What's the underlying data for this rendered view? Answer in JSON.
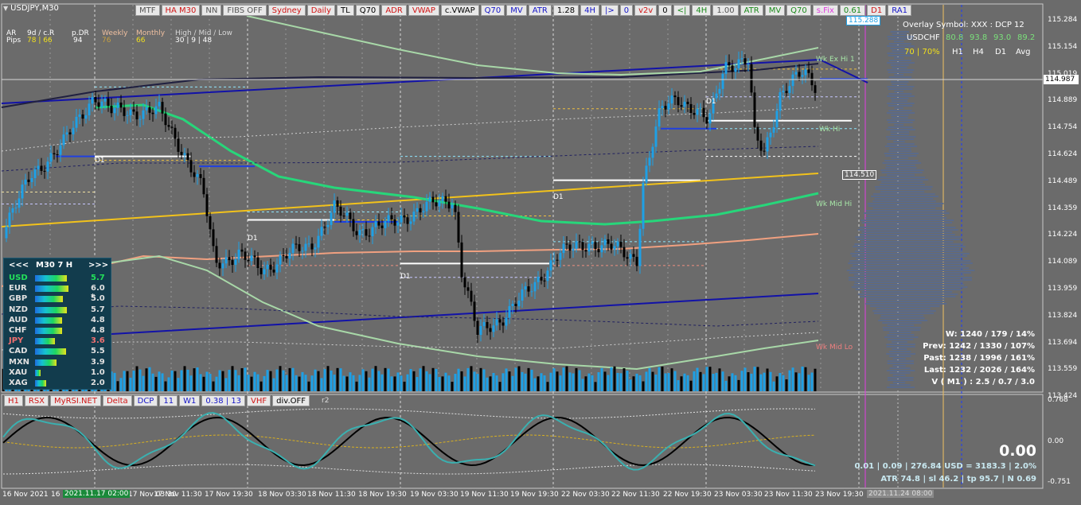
{
  "window": {
    "symbol_title": "USDJPY,M30"
  },
  "toolbar": [
    {
      "label": "MTF",
      "color": "#555555"
    },
    {
      "label": "HA M30",
      "color": "#d11414"
    },
    {
      "label": "NN",
      "color": "#555555"
    },
    {
      "label": "FIBS OFF",
      "color": "#555555"
    },
    {
      "label": "Sydney",
      "color": "#d11414"
    },
    {
      "label": "Daily",
      "color": "#d11414"
    },
    {
      "label": "TL",
      "color": "#000000"
    },
    {
      "label": "Q70",
      "color": "#000000"
    },
    {
      "label": "ADR",
      "color": "#d11414"
    },
    {
      "label": "VWAP",
      "color": "#d11414"
    },
    {
      "label": "c.VWAP",
      "color": "#000000"
    },
    {
      "label": "Q70",
      "color": "#1515c8"
    },
    {
      "label": "MV",
      "color": "#1515c8"
    },
    {
      "label": "ATR",
      "color": "#1515c8"
    },
    {
      "label": "1.28",
      "color": "#000000"
    },
    {
      "label": "4H",
      "color": "#1515c8"
    },
    {
      "label": "|>",
      "color": "#1515c8"
    },
    {
      "label": "0",
      "color": "#1515c8"
    },
    {
      "label": "v2v",
      "color": "#d11414"
    },
    {
      "label": "0",
      "color": "#000000"
    },
    {
      "label": "<|",
      "color": "#1a8a1a"
    },
    {
      "label": "4H",
      "color": "#1a8a1a"
    },
    {
      "label": "1.00",
      "color": "#555555"
    },
    {
      "label": "ATR",
      "color": "#1a8a1a"
    },
    {
      "label": "MV",
      "color": "#1a8a1a"
    },
    {
      "label": "Q70",
      "color": "#1a8a1a"
    },
    {
      "label": "s.Fix",
      "color": "#e03ce0"
    },
    {
      "label": "0.61",
      "color": "#1a8a1a"
    },
    {
      "label": "D1",
      "color": "#d11414"
    },
    {
      "label": "RA1",
      "color": "#1515c8"
    }
  ],
  "subwindow_toolbar": [
    {
      "label": "H1",
      "color": "#d11414"
    },
    {
      "label": "RSX",
      "color": "#d11414"
    },
    {
      "label": "MyRSI.NET",
      "color": "#d11414"
    },
    {
      "label": "Delta",
      "color": "#d11414"
    },
    {
      "label": "DCP",
      "color": "#1515c8"
    },
    {
      "label": "11",
      "color": "#1515c8"
    },
    {
      "label": "W1",
      "color": "#1515c8"
    },
    {
      "label": "0.38 | 13",
      "color": "#1515c8"
    },
    {
      "label": "VHF",
      "color": "#d11414"
    },
    {
      "label": "div.OFF",
      "color": "#000000"
    }
  ],
  "subwindow_tail": "r2",
  "info": {
    "ar_label": "AR",
    "pips_label": "Pips",
    "dcr_label": "9d / c.R",
    "dcr_value": "78 | 66",
    "pdr_label": "p.DR",
    "pdr_value": "94",
    "weekly_label": "Weekly",
    "weekly_value": "76",
    "monthly_label": "Monthly",
    "monthly_value": "66",
    "hml_label": "High / Mid / Low",
    "hml_value": "30  |  9  |  48"
  },
  "strength": {
    "header_left": "<<<",
    "header_mid": "M30  7  H",
    "header_right": ">>>",
    "rows": [
      {
        "cur": "USD",
        "val": "5.7",
        "color": "#23e05a",
        "fill": 0.57
      },
      {
        "cur": "EUR",
        "val": "6.0 *",
        "color": "#e0e0e0",
        "fill": 0.6
      },
      {
        "cur": "GBP",
        "val": "5.0",
        "color": "#e0e0e0",
        "fill": 0.5
      },
      {
        "cur": "NZD",
        "val": "5.7",
        "color": "#e0e0e0",
        "fill": 0.57
      },
      {
        "cur": "AUD",
        "val": "4.8",
        "color": "#e0e0e0",
        "fill": 0.48
      },
      {
        "cur": "CHF",
        "val": "4.8",
        "color": "#e0e0e0",
        "fill": 0.48
      },
      {
        "cur": "JPY",
        "val": "3.6",
        "color": "#f07070",
        "fill": 0.36
      },
      {
        "cur": "CAD",
        "val": "5.5",
        "color": "#e0e0e0",
        "fill": 0.55
      },
      {
        "cur": "MXN",
        "val": "3.9",
        "color": "#e0e0e0",
        "fill": 0.39
      },
      {
        "cur": "XAU",
        "val": "1.0",
        "color": "#e0e0e0",
        "fill": 0.1
      },
      {
        "cur": "XAG",
        "val": "2.0",
        "color": "#e0e0e0",
        "fill": 0.2
      }
    ]
  },
  "overlay": {
    "line1": "Overlay Symbol: XXX : DCP 12",
    "symbol": "USDCHF",
    "v1": "80.8",
    "v2": "93.8",
    "v3": "93.0",
    "v4": "89.2",
    "pct": "70 | 70%",
    "h1": "H1",
    "h4": "H4",
    "d1": "D1",
    "avg": "Avg"
  },
  "stats": [
    "W: 1240 / 179 / 14%",
    "Prev: 1242 / 1330 / 107%",
    "Past: 1238 / 1996 / 161%",
    "Last: 1232 / 2026 / 164%",
    "V ( M1 ) : 2.5 / 0.7 / 3.0"
  ],
  "sub_readout": {
    "big": "0.00",
    "line1": "0.01  |  0.09  |  276.84 USD = 3183.3  |  2.0%",
    "line2": "ATR 74.8  |  sl 46.2  |  tp 95.7  |  N 0.69"
  },
  "price_axis": [
    "115.284",
    "115.154",
    "115.019",
    "114.889",
    "114.754",
    "114.624",
    "114.489",
    "114.359",
    "114.224",
    "114.089",
    "113.959",
    "113.824",
    "113.694",
    "113.559",
    "113.424"
  ],
  "current_price": "114.987",
  "top_price_box": "115.288",
  "level_box": "114.510",
  "sub_axis": [
    "0.768",
    "0.00",
    "-0.751"
  ],
  "time_axis": [
    "16 Nov 2021",
    "16",
    "17 Nov 03:30",
    "17 Nov 11:30",
    "17 Nov 19:30",
    "18 Nov 03:30",
    "18 Nov 11:30",
    "18 Nov 19:30",
    "19 Nov 03:30",
    "19 Nov 11:30",
    "19 Nov 19:30",
    "22 Nov 03:30",
    "22 Nov 11:30",
    "22 Nov 19:30",
    "23 Nov 03:30",
    "23 Nov 11:30",
    "23 Nov 19:30"
  ],
  "time_highlight_left": "2021.11.17 02:00",
  "time_highlight_right": "2021.11.24 08:00",
  "chart_labels": {
    "wk_ex_hi": "Wk Ex Hi 1",
    "wk_hi": "Wk Hi",
    "wk_mid_hi": "Wk Mid Hi",
    "wk_mid_lo": "Wk Mid Lo",
    "d1": "D1"
  },
  "colors": {
    "background": "#6b6b6b",
    "bull": "#1ea0e6",
    "bear": "#000000",
    "ma_green": "#27d67a",
    "yellow_trend": "#f2c21b",
    "blue_trend": "#1212a8",
    "salmon": "#f0a080",
    "pale_green": "#a8d8a8"
  }
}
